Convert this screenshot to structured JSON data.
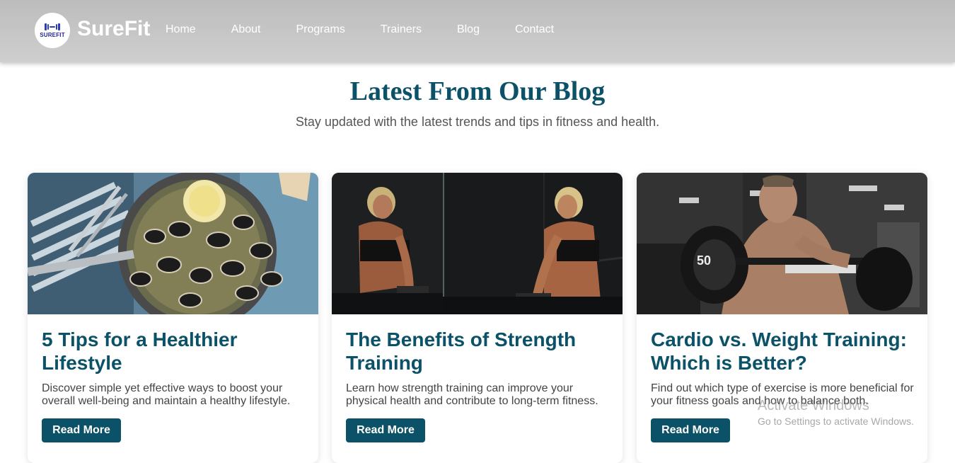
{
  "brand": {
    "logo_text": "SUREFIT",
    "name": "SureFit"
  },
  "nav": [
    "Home",
    "About",
    "Programs",
    "Trainers",
    "Blog",
    "Contact"
  ],
  "section": {
    "title": "Latest From Our Blog",
    "subtitle": "Stay updated with the latest trends and tips in fitness and health."
  },
  "posts": [
    {
      "title": "5 Tips for a Healthier Lifestyle",
      "excerpt": "Discover simple yet effective ways to boost your overall well-being and maintain a healthy lifestyle.",
      "button": "Read More",
      "image": "clams-pan-photo"
    },
    {
      "title": "The Benefits of Strength Training",
      "excerpt": "Learn how strength training can improve your physical health and contribute to long-term fitness.",
      "button": "Read More",
      "image": "strength-training-mirror-photo"
    },
    {
      "title": "Cardio vs. Weight Training: Which is Better?",
      "excerpt": "Find out which type of exercise is more beneficial for your fitness goals and how to balance both.",
      "button": "Read More",
      "image": "barbell-curl-photo"
    }
  ],
  "watermark": {
    "line1": "Activate Windows",
    "line2": "Go to Settings to activate Windows."
  },
  "colors": {
    "accent": "#0b5268",
    "navbar": "#c4c4c4",
    "logo_blue": "#2c3cbb"
  }
}
